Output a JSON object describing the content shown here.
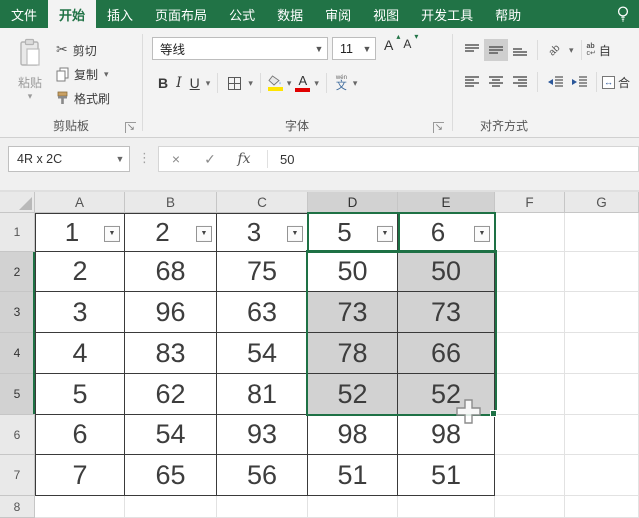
{
  "menubar": {
    "tabs": [
      {
        "label": "文件"
      },
      {
        "label": "开始"
      },
      {
        "label": "插入"
      },
      {
        "label": "页面布局"
      },
      {
        "label": "公式"
      },
      {
        "label": "数据"
      },
      {
        "label": "审阅"
      },
      {
        "label": "视图"
      },
      {
        "label": "开发工具"
      },
      {
        "label": "帮助"
      }
    ],
    "active_tab": "开始"
  },
  "ribbon": {
    "clipboard": {
      "label": "剪贴板",
      "paste": "粘贴",
      "cut": "剪切",
      "copy": "复制",
      "format_painter": "格式刷"
    },
    "font": {
      "label": "字体",
      "font_name": "等线",
      "font_size": "11",
      "bold": "B",
      "italic": "I",
      "underline": "U",
      "phonetic_top": "wén",
      "phonetic": "文"
    },
    "alignment": {
      "label": "对齐方式",
      "wrap_icon_top": "ab",
      "wrap_icon_bottom": "c↵",
      "wrap_text_partial": "自",
      "merge_arrow": "↔",
      "merge_partial": "合"
    }
  },
  "formula_bar": {
    "name_box": "4R x 2C",
    "cancel": "×",
    "enter": "✓",
    "fx_label": "fx",
    "formula_value": "50"
  },
  "grid": {
    "col_headers": [
      "A",
      "B",
      "C",
      "D",
      "E",
      "F",
      "G"
    ],
    "row_headers": [
      "1",
      "2",
      "3",
      "4",
      "5",
      "6",
      "7",
      "8"
    ],
    "data_rows": [
      [
        "1",
        "2",
        "3",
        "5",
        "6"
      ],
      [
        "2",
        "68",
        "75",
        "50",
        "50"
      ],
      [
        "3",
        "96",
        "63",
        "73",
        "73"
      ],
      [
        "4",
        "83",
        "54",
        "78",
        "66"
      ],
      [
        "5",
        "62",
        "81",
        "52",
        "52"
      ],
      [
        "6",
        "54",
        "93",
        "98",
        "98"
      ],
      [
        "7",
        "65",
        "56",
        "51",
        "51"
      ]
    ],
    "filter_row": "1",
    "filter_glyph": "▼",
    "selection": {
      "range": "D2:E5",
      "name_box_text": "4R x 2C",
      "active_cell": "D2",
      "selected_cells": [
        "E2",
        "D3",
        "E3",
        "D4",
        "E4",
        "D5",
        "E5"
      ],
      "selected_col_headers": [
        "D",
        "E"
      ],
      "selected_row_headers": [
        "2",
        "3",
        "4",
        "5"
      ]
    }
  },
  "colors": {
    "excel_green": "#217346",
    "selection_border": "#1e7145",
    "selection_fill": "#d2d2d2",
    "header_fill": "#e9e9e9",
    "selected_header_fill": "#d2d2d2",
    "fill_color_swatch": "#ffe400",
    "font_color_swatch": "#e00000"
  }
}
